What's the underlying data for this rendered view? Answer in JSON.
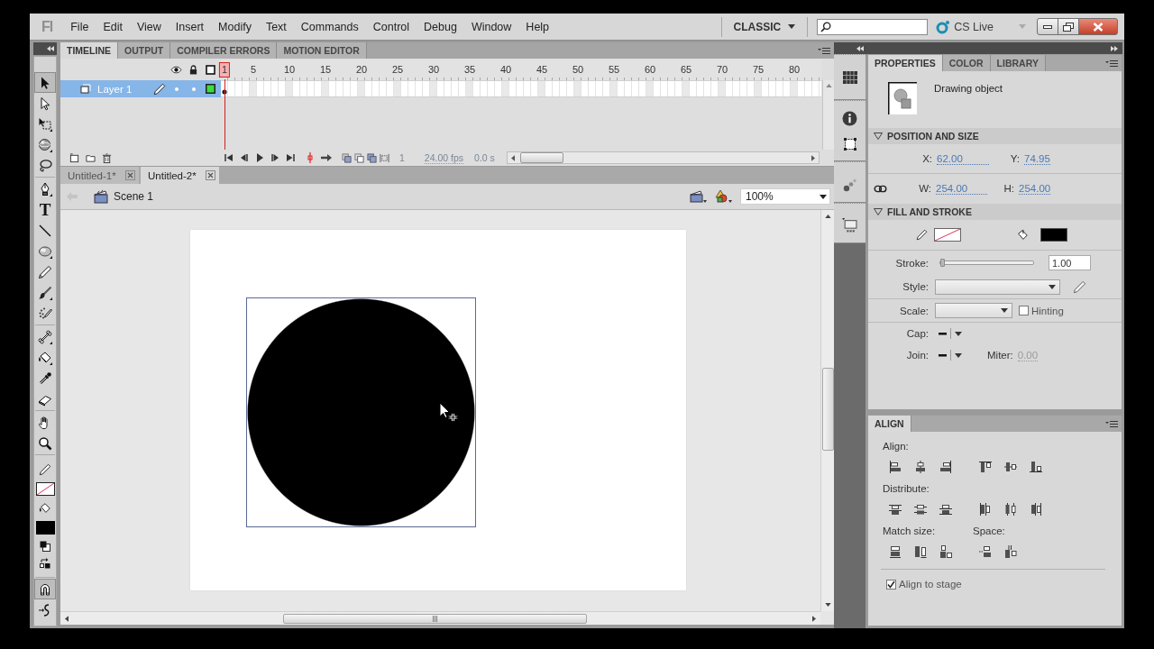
{
  "menu_bar": {
    "logo": "Fl",
    "menus": [
      "File",
      "Edit",
      "View",
      "Insert",
      "Modify",
      "Text",
      "Commands",
      "Control",
      "Debug",
      "Window",
      "Help"
    ],
    "workspace": "CLASSIC",
    "cs_live": "CS Live"
  },
  "tools": {
    "groups": [
      [
        {
          "kind": "selection",
          "selected": true
        },
        {
          "kind": "subselection",
          "selected": false
        },
        {
          "kind": "transform",
          "selected": false
        },
        {
          "kind": "rotation",
          "selected": false
        },
        {
          "kind": "lasso",
          "selected": false
        }
      ],
      [
        {
          "kind": "pen",
          "selected": false
        },
        {
          "kind": "text",
          "label": "T",
          "selected": false
        },
        {
          "kind": "line",
          "selected": false
        },
        {
          "kind": "oval",
          "selected": false
        },
        {
          "kind": "pencil",
          "selected": false
        },
        {
          "kind": "brush",
          "selected": false
        },
        {
          "kind": "deco",
          "selected": false
        }
      ],
      [
        {
          "kind": "bone",
          "selected": false
        },
        {
          "kind": "bucket",
          "selected": false
        },
        {
          "kind": "eyedropper",
          "selected": false
        },
        {
          "kind": "eraser",
          "selected": false
        }
      ],
      [
        {
          "kind": "hand",
          "selected": false
        },
        {
          "kind": "zoom",
          "selected": false
        }
      ]
    ],
    "options": [
      {
        "kind": "snap",
        "on": true
      },
      {
        "kind": "smooth",
        "on": false
      }
    ]
  },
  "timeline": {
    "tabs": [
      {
        "label": "TIMELINE",
        "selected": true
      },
      {
        "label": "OUTPUT",
        "selected": false
      },
      {
        "label": "COMPILER ERRORS",
        "selected": false
      },
      {
        "label": "MOTION EDITOR",
        "selected": false
      }
    ],
    "frame_numbers": [
      {
        "label": "1",
        "current": true
      },
      {
        "label": "5",
        "current": false
      },
      {
        "label": "10",
        "current": false
      },
      {
        "label": "15",
        "current": false
      },
      {
        "label": "20",
        "current": false
      },
      {
        "label": "25",
        "current": false
      },
      {
        "label": "30",
        "current": false
      },
      {
        "label": "35",
        "current": false
      },
      {
        "label": "40",
        "current": false
      },
      {
        "label": "45",
        "current": false
      },
      {
        "label": "50",
        "current": false
      },
      {
        "label": "55",
        "current": false
      },
      {
        "label": "60",
        "current": false
      },
      {
        "label": "65",
        "current": false
      },
      {
        "label": "70",
        "current": false
      },
      {
        "label": "75",
        "current": false
      },
      {
        "label": "80",
        "current": false
      }
    ],
    "layers": [
      {
        "name": "Layer 1",
        "selected": true,
        "color": "#3fdb3f"
      }
    ],
    "current_frame": "1",
    "frame_rate": "24.00 fps",
    "elapsed_time": "0.0 s"
  },
  "document_tabs": [
    {
      "label": "Untitled-1*",
      "selected": false
    },
    {
      "label": "Untitled-2*",
      "selected": true
    }
  ],
  "edit_bar": {
    "scene": "Scene 1",
    "zoom": "100%"
  },
  "stage": {
    "shapes": [
      {
        "kind": "oval",
        "selected": true
      }
    ]
  },
  "properties": {
    "tabs": [
      {
        "label": "PROPERTIES",
        "selected": true
      },
      {
        "label": "COLOR",
        "selected": false
      },
      {
        "label": "LIBRARY",
        "selected": false
      }
    ],
    "object_type": "Drawing object",
    "position_and_size": {
      "title": "POSITION AND SIZE",
      "expanded": true,
      "fields": [
        {
          "label": "X:",
          "value": "62.00"
        },
        {
          "label": "Y:",
          "value": "74.95"
        },
        {
          "label": "W:",
          "value": "254.00"
        },
        {
          "label": "H:",
          "value": "254.00"
        }
      ]
    },
    "fill_and_stroke": {
      "title": "FILL AND STROKE",
      "expanded": true,
      "stroke_label": "Stroke:",
      "stroke_slider": {
        "level": 0.005
      },
      "stroke_value": "1.00",
      "style_label": "Style:",
      "scale_label": "Scale:",
      "hinting": {
        "label": "Hinting",
        "checked": false
      },
      "cap_label": "Cap:",
      "join_label": "Join:",
      "miter": {
        "label": "Miter:",
        "value": "0.00",
        "disabled": true
      }
    }
  },
  "align": {
    "tabs": [
      {
        "label": "ALIGN",
        "selected": true
      }
    ],
    "groups": [
      {
        "label": "Align:",
        "buttons": [
          {
            "kind": "align-left"
          },
          {
            "kind": "align-hcenter"
          },
          {
            "kind": "align-right"
          },
          {
            "kind": "align-top"
          },
          {
            "kind": "align-vcenter"
          },
          {
            "kind": "align-bottom"
          }
        ]
      },
      {
        "label": "Distribute:",
        "buttons": [
          {
            "kind": "distribute-top"
          },
          {
            "kind": "distribute-vcenter"
          },
          {
            "kind": "distribute-bottom"
          },
          {
            "kind": "distribute-left"
          },
          {
            "kind": "distribute-hcenter"
          },
          {
            "kind": "distribute-right"
          }
        ]
      },
      {
        "label": "Match size:",
        "buttons": [
          {
            "kind": "match-width"
          },
          {
            "kind": "match-height"
          },
          {
            "kind": "match-both"
          }
        ]
      },
      {
        "label": "Space:",
        "buttons": [
          {
            "kind": "space-vertical"
          },
          {
            "kind": "space-horizontal"
          }
        ]
      }
    ],
    "align_to_stage": {
      "label": "Align to stage",
      "checked": true
    }
  }
}
